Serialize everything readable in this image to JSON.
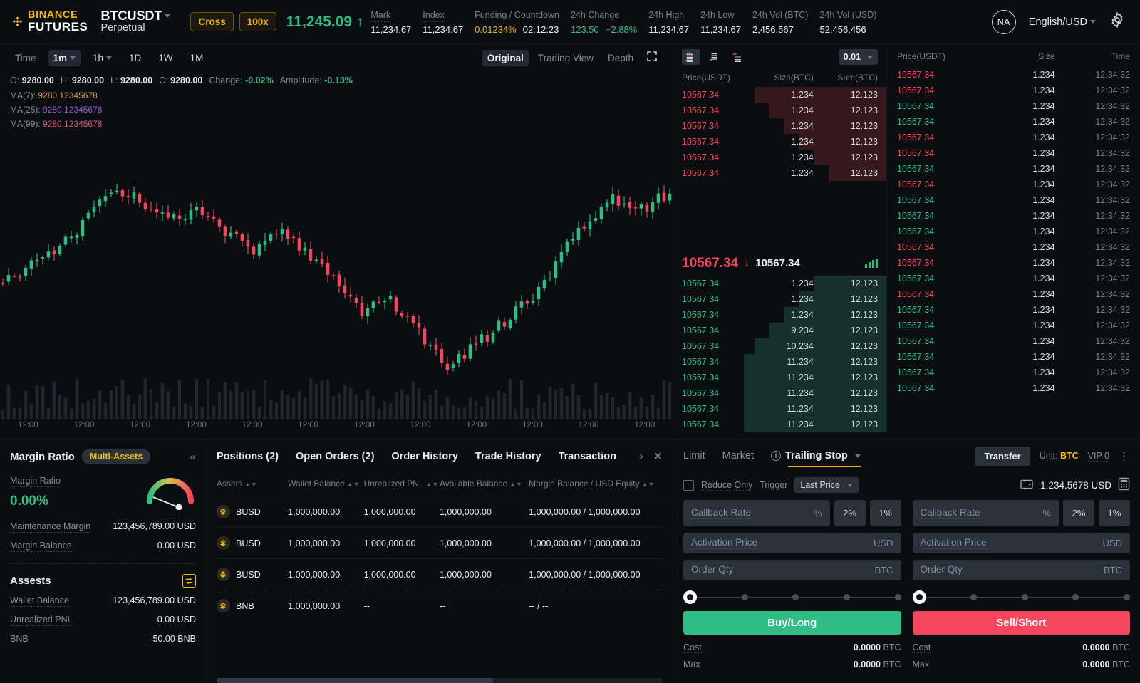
{
  "header": {
    "logo_line1": "BINANCE",
    "logo_line2": "FUTURES",
    "logo_icon": "binance-diamond-icon",
    "pair_symbol": "BTCUSDT",
    "pair_type": "Perpetual",
    "margin_mode": "Cross",
    "leverage": "100x",
    "last_price": "11,245.09",
    "last_price_arrow": "↑",
    "stats": [
      {
        "label": "Mark",
        "value": "11,234.67"
      },
      {
        "label": "Index",
        "value": "11,234.67"
      }
    ],
    "funding_label": "Funding / Countdown",
    "funding_rate": "0.01234%",
    "funding_countdown": "02:12:23",
    "change_label": "24h Change",
    "change_value": "123.50",
    "change_pct": "+2.88%",
    "high_label": "24h High",
    "high_value": "11,234.67",
    "low_label": "24h Low",
    "low_value": "11,234.67",
    "vol_btc_label": "24h Vol (BTC)",
    "vol_btc_value": "2,456.567",
    "vol_usd_label": "24h Vol  (USD)",
    "vol_usd_value": "52,456,456",
    "avatar_initials": "NA",
    "language": "English/USD",
    "settings_icon": "gear-icon"
  },
  "chart": {
    "toolbar": {
      "time_label": "Time",
      "intervals": [
        "1m",
        "1h",
        "1D",
        "1W",
        "1M"
      ],
      "active_interval": "1m",
      "views": [
        "Original",
        "Trading View",
        "Depth"
      ],
      "active_view": "Original",
      "fullscreen_icon": "fullscreen-icon"
    },
    "ohlc": {
      "o_label": "O:",
      "o": "9280.00",
      "h_label": "H:",
      "h": "9280.00",
      "l_label": "L:",
      "l": "9280.00",
      "c_label": "C:",
      "c": "9280.00",
      "change_label": "Change:",
      "change": "-0.02%",
      "amplitude_label": "Amplitude:",
      "amplitude": "-0.13%"
    },
    "ma": [
      {
        "label": "MA(7):",
        "value": "9280.12345678",
        "color": "#e8a33d"
      },
      {
        "label": "MA(25):",
        "value": "9280.12345678",
        "color": "#9b5ad6"
      },
      {
        "label": "MA(99):",
        "value": "9280.12345678",
        "color": "#e0558a"
      }
    ],
    "time_ticks": [
      "12:00",
      "12:00",
      "12:00",
      "12:00",
      "12:00",
      "12:00",
      "12:00",
      "12:00",
      "12:00",
      "12:00",
      "12:00",
      "12:00"
    ],
    "colors": {
      "up": "#2ebd85",
      "down": "#f6465d"
    }
  },
  "orderbook": {
    "tick_size": "0.01",
    "layout_icons": [
      "book-both-icon",
      "book-bids-icon",
      "book-asks-icon"
    ],
    "active_layout": "book-both-icon",
    "headers": [
      "Price(USDT)",
      "Size(BTC)",
      "Sum(BTC)"
    ],
    "asks": [
      {
        "price": "10567.34",
        "size": "1.234",
        "sum": "12.123",
        "depth": 62
      },
      {
        "price": "10567.34",
        "size": "1.234",
        "sum": "12.123",
        "depth": 55
      },
      {
        "price": "10567.34",
        "size": "1.234",
        "sum": "12.123",
        "depth": 48
      },
      {
        "price": "10567.34",
        "size": "1.234",
        "sum": "12.123",
        "depth": 41
      },
      {
        "price": "10567.34",
        "size": "1.234",
        "sum": "12.123",
        "depth": 34
      },
      {
        "price": "10567.34",
        "size": "1.234",
        "sum": "12.123",
        "depth": 27
      }
    ],
    "mid": {
      "price": "10567.34",
      "arrow": "↓",
      "secondary": "10567.34",
      "spark_icon": "signal-bars-icon"
    },
    "bids": [
      {
        "price": "10567.34",
        "size": "1.234",
        "sum": "12.123",
        "depth": 34
      },
      {
        "price": "10567.34",
        "size": "1.234",
        "sum": "12.123",
        "depth": 41
      },
      {
        "price": "10567.34",
        "size": "1.234",
        "sum": "12.123",
        "depth": 48
      },
      {
        "price": "10567.34",
        "size": "9.234",
        "sum": "12.123",
        "depth": 55
      },
      {
        "price": "10567.34",
        "size": "10.234",
        "sum": "12.123",
        "depth": 62
      },
      {
        "price": "10567.34",
        "size": "11.234",
        "sum": "12.123",
        "depth": 67
      },
      {
        "price": "10567.34",
        "size": "11.234",
        "sum": "12.123",
        "depth": 67
      },
      {
        "price": "10567.34",
        "size": "11.234",
        "sum": "12.123",
        "depth": 67
      },
      {
        "price": "10567.34",
        "size": "11.234",
        "sum": "12.123",
        "depth": 67
      },
      {
        "price": "10567.34",
        "size": "11.234",
        "sum": "12.123",
        "depth": 67
      }
    ]
  },
  "trades": {
    "headers": [
      "Price(USDT)",
      "Size",
      "Time"
    ],
    "rows": [
      {
        "price": "10567.34",
        "size": "1.234",
        "time": "12:34:32",
        "side": "sell"
      },
      {
        "price": "10567.34",
        "size": "1.234",
        "time": "12:34:32",
        "side": "sell"
      },
      {
        "price": "10567.34",
        "size": "1.234",
        "time": "12:34:32",
        "side": "buy"
      },
      {
        "price": "10567.34",
        "size": "1.234",
        "time": "12:34:32",
        "side": "buy"
      },
      {
        "price": "10567.34",
        "size": "1.234",
        "time": "12:34:32",
        "side": "sell"
      },
      {
        "price": "10567.34",
        "size": "1.234",
        "time": "12:34:32",
        "side": "sell"
      },
      {
        "price": "10567.34",
        "size": "1.234",
        "time": "12:34:32",
        "side": "buy"
      },
      {
        "price": "10567.34",
        "size": "1.234",
        "time": "12:34:32",
        "side": "sell"
      },
      {
        "price": "10567.34",
        "size": "1.234",
        "time": "12:34:32",
        "side": "buy"
      },
      {
        "price": "10567.34",
        "size": "1.234",
        "time": "12:34:32",
        "side": "buy"
      },
      {
        "price": "10567.34",
        "size": "1.234",
        "time": "12:34:32",
        "side": "buy"
      },
      {
        "price": "10567.34",
        "size": "1.234",
        "time": "12:34:32",
        "side": "sell"
      },
      {
        "price": "10567.34",
        "size": "1.234",
        "time": "12:34:32",
        "side": "sell"
      },
      {
        "price": "10567.34",
        "size": "1.234",
        "time": "12:34:32",
        "side": "buy"
      },
      {
        "price": "10567.34",
        "size": "1.234",
        "time": "12:34:32",
        "side": "sell"
      },
      {
        "price": "10567.34",
        "size": "1.234",
        "time": "12:34:32",
        "side": "buy"
      },
      {
        "price": "10567.34",
        "size": "1.234",
        "time": "12:34:32",
        "side": "buy"
      },
      {
        "price": "10567.34",
        "size": "1.234",
        "time": "12:34:32",
        "side": "buy"
      },
      {
        "price": "10567.34",
        "size": "1.234",
        "time": "12:34:32",
        "side": "buy"
      },
      {
        "price": "10567.34",
        "size": "1.234",
        "time": "12:34:32",
        "side": "buy"
      },
      {
        "price": "10567.34",
        "size": "1.234",
        "time": "12:34:32",
        "side": "buy"
      }
    ]
  },
  "order_form": {
    "tabs": [
      "Limit",
      "Market",
      "Trailing Stop"
    ],
    "active_tab": "Trailing Stop",
    "tab_info_icon": "info-icon",
    "tab_caret_icon": "chevron-down-icon",
    "transfer_label": "Transfer",
    "unit_label": "Unit:",
    "unit_value": "BTC",
    "vip_label": "VIP 0",
    "more_icon": "kebab-menu-icon",
    "reduce_only_label": "Reduce Only",
    "trigger_label": "Trigger",
    "trigger_value": "Last Price",
    "wallet_icon": "wallet-icon",
    "balance": "1,234.5678 USD",
    "calculator_icon": "calculator-icon",
    "buy": {
      "callback_rate_placeholder": "Callback Rate",
      "callback_rate_suffix": "%",
      "quick_pcts": [
        "2%",
        "1%"
      ],
      "activation_price_placeholder": "Activation Price",
      "activation_price_suffix": "USD",
      "order_qty_placeholder": "Order Qty",
      "order_qty_suffix": "BTC",
      "button_label": "Buy/Long",
      "button_color": "#2ebd85",
      "cost_label": "Cost",
      "cost_value": "0.0000",
      "cost_unit": "BTC",
      "max_label": "Max",
      "max_value": "0.0000",
      "max_unit": "BTC"
    },
    "sell": {
      "callback_rate_placeholder": "Callback Rate",
      "callback_rate_suffix": "%",
      "quick_pcts": [
        "2%",
        "1%"
      ],
      "activation_price_placeholder": "Activation Price",
      "activation_price_suffix": "USD",
      "order_qty_placeholder": "Order Qty",
      "order_qty_suffix": "BTC",
      "button_label": "Sell/Short",
      "button_color": "#f6465d",
      "cost_label": "Cost",
      "cost_value": "0.0000",
      "cost_unit": "BTC",
      "max_label": "Max",
      "max_value": "0.0000",
      "max_unit": "BTC"
    }
  },
  "margin_panel": {
    "title": "Margin Ratio",
    "chip": "Multi-Assets",
    "collapse_icon": "collapse-left-icon",
    "ratio_label": "Margin Ratio",
    "ratio_value": "0.00%",
    "gauge_icon": "gauge-icon",
    "rows": [
      {
        "label": "Maintenance Margin",
        "value": "123,456,789.00 USD"
      },
      {
        "label": "Margin Balance",
        "value": "0.00 USD"
      }
    ],
    "assets_title": "Assests",
    "transfer_icon": "transfer-arrows-icon",
    "asset_rows": [
      {
        "label": "Wallet Balance",
        "value": "123,456,789.00 USD"
      },
      {
        "label": "Unrealized PNL",
        "value": "0.00 USD"
      },
      {
        "label": "BNB",
        "value": "50.00 BNB"
      }
    ]
  },
  "positions": {
    "tabs": [
      "Positions (2)",
      "Open Orders (2)",
      "Order History",
      "Trade History",
      "Transaction"
    ],
    "active_tab": "Positions (2)",
    "next_icon": "chevron-right-icon",
    "close_icon": "close-icon",
    "columns": [
      "Assets",
      "Wallet Balance",
      "Unrealized PNL",
      "Available Balance",
      "Margin Balance / USD Equity"
    ],
    "rows": [
      {
        "asset": "BUSD",
        "icon": "busd-coin-icon",
        "wallet": "1,000,000.00",
        "upnl": "1,000,000.00",
        "available": "1,000,000.00",
        "margin": "1,000,000.00 / 1,000,000.00"
      },
      {
        "asset": "BUSD",
        "icon": "busd-coin-icon",
        "wallet": "1,000,000.00",
        "upnl": "1,000,000.00",
        "available": "1,000,000.00",
        "margin": "1,000,000.00 / 1,000,000.00"
      },
      {
        "asset": "BUSD",
        "icon": "busd-coin-icon",
        "wallet": "1,000,000.00",
        "upnl": "1,000,000.00",
        "available": "1,000,000.00",
        "margin": "1,000,000.00 / 1,000,000.00"
      },
      {
        "asset": "BNB",
        "icon": "bnb-coin-icon",
        "wallet": "1,000,000.00",
        "upnl": "--",
        "available": "--",
        "margin": "-- / --"
      }
    ]
  }
}
